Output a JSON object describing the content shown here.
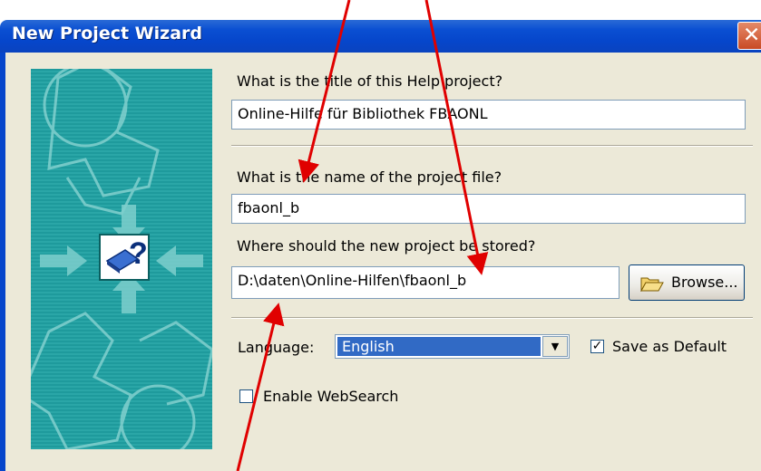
{
  "window": {
    "title": "New Project Wizard",
    "close_glyph": "✕"
  },
  "form": {
    "title_question": "What is the title of this Help project?",
    "title_value": "Online-Hilfe für Bibliothek FBAONL",
    "file_question": "What is the name of the project file?",
    "file_value": "fbaonl_b",
    "location_question": "Where should the new project be stored?",
    "location_value": "D:\\daten\\Online-Hilfen\\fbaonl_b",
    "browse_label": "Browse...",
    "language_label": "Language:",
    "language_value": "English",
    "save_default_label": "Save as Default",
    "save_default_checked": "✓",
    "enable_websearch_label": "Enable WebSearch"
  },
  "icons": {
    "browse_icon": "folder-open-icon",
    "wizard_icon": "help-book-icon"
  },
  "colors": {
    "title_bar": "#0a4fd2",
    "dialog_bg": "#ece9d8",
    "selection": "#316ac5",
    "annotation_arrow": "#e00000",
    "side_image": "#1e9a9c"
  }
}
